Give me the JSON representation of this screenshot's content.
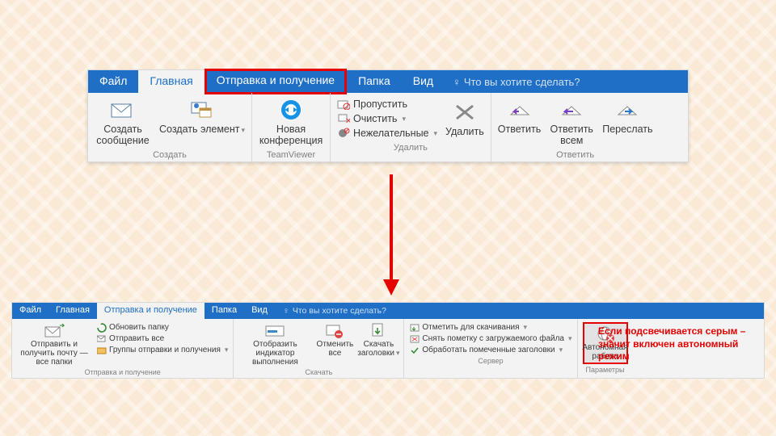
{
  "top": {
    "tabs": {
      "file": "Файл",
      "home": "Главная",
      "sendrecv": "Отправка и получение",
      "folder": "Папка",
      "view": "Вид",
      "tell": "Что вы хотите сделать?"
    },
    "groups": {
      "create": {
        "label": "Создать",
        "newmsg": "Создать сообщение",
        "newitem": "Создать элемент"
      },
      "tv": {
        "label": "TeamViewer",
        "newconf": "Новая конференция"
      },
      "delete": {
        "label": "Удалить",
        "ignore": "Пропустить",
        "cleanup": "Очистить",
        "junk": "Нежелательные",
        "del": "Удалить"
      },
      "respond": {
        "label": "Ответить",
        "reply": "Ответить",
        "replyall": "Ответить всем",
        "forward": "Переслать"
      }
    }
  },
  "bottom": {
    "tabs": {
      "file": "Файл",
      "home": "Главная",
      "sendrecv": "Отправка и получение",
      "folder": "Папка",
      "view": "Вид",
      "tell": "Что вы хотите сделать?"
    },
    "groups": {
      "sendrecv": {
        "label": "Отправка и получение",
        "sendall": "Отправить и получить почту — все папки",
        "updfolder": "Обновить папку",
        "sendallbtn": "Отправить все",
        "srgroups": "Группы отправки и получения"
      },
      "download": {
        "label": "Скачать",
        "showprog": "Отобразить индикатор выполнения",
        "cancelall": "Отменить все",
        "dlheaders": "Скачать заголовки"
      },
      "server": {
        "label": "Сервер",
        "mark": "Отметить для скачивания",
        "unmark": "Снять пометку с загружаемого файла",
        "process": "Обработать помеченные заголовки"
      },
      "params": {
        "label": "Параметры",
        "offline": "Автономная работа"
      }
    }
  },
  "note": "Если подсвечивается серым – значит включен автономный режим"
}
